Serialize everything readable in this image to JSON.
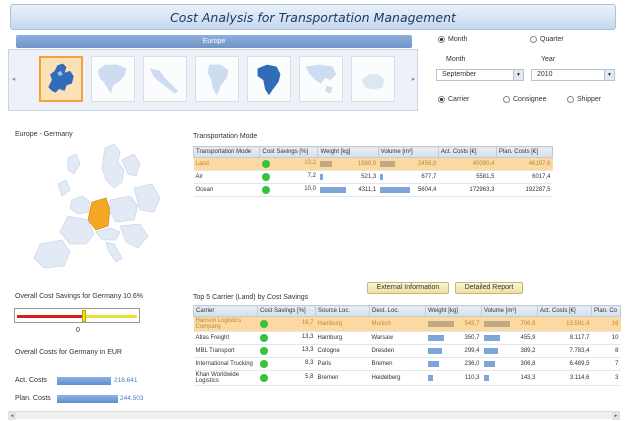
{
  "title": "Cost Analysis for Transportation Management",
  "region": {
    "label": "Europe",
    "tiles": [
      {
        "name": "europe",
        "selected": true
      },
      {
        "name": "north-america",
        "selected": false
      },
      {
        "name": "central-america",
        "selected": false
      },
      {
        "name": "south-america",
        "selected": false
      },
      {
        "name": "africa",
        "selected": false
      },
      {
        "name": "asia",
        "selected": false
      },
      {
        "name": "oceania",
        "selected": false
      }
    ]
  },
  "period": {
    "month_option": "Month",
    "quarter_option": "Quarter",
    "month_label": "Month",
    "year_label": "Year",
    "month_value": "September",
    "year_value": "2010"
  },
  "partner": {
    "carrier": "Carrier",
    "consignee": "Consignee",
    "shipper": "Shipper"
  },
  "map_title": "Europe - Germany",
  "savings": {
    "label": "Overall Cost Savings for Germany 10.6%",
    "zero": "0",
    "value_percent": 10.6
  },
  "costs": {
    "label": "Overall Costs for Germany in EUR",
    "act_label": "Act. Costs",
    "act_value": "218.641",
    "plan_label": "Plan. Costs",
    "plan_value": "244.503"
  },
  "transport_mode": {
    "title": "Transportation Mode",
    "headers": [
      "Transportation Mode",
      "Cost Savings [%]",
      "Weight [kg]",
      "Volume [m³]",
      "Act. Costs [€]",
      "Plan. Costs [€]"
    ],
    "rows": [
      {
        "mode": "Land",
        "savings": "13,2",
        "weight": "1989,9",
        "volume": "2456,9",
        "act": "40090,4",
        "plan": "46197,6",
        "highlight": true
      },
      {
        "mode": "Air",
        "savings": "7,2",
        "weight": "521,3",
        "volume": "677,7",
        "act": "5581,5",
        "plan": "6017,4",
        "highlight": false
      },
      {
        "mode": "Ocean",
        "savings": "10,0",
        "weight": "4311,1",
        "volume": "5604,4",
        "act": "172963,3",
        "plan": "192287,5",
        "highlight": false
      }
    ]
  },
  "buttons": {
    "external": "External Information",
    "report": "Detailed Report"
  },
  "top_carriers": {
    "title": "Top 5 Carrier (Land) by Cost Savings",
    "headers": [
      "Carrier",
      "Cost Savings [%]",
      "Source Loc.",
      "Dest. Loc.",
      "Weight [kg]",
      "Volume [m³]",
      "Act. Costs [€]",
      "Plan. Co"
    ],
    "rows": [
      {
        "carrier": "Hanson Logistics Company",
        "savings": "16,7",
        "source": "Hamburg",
        "dest": "Munich",
        "weight": "543,7",
        "volume": "706,8",
        "act": "13.591,4",
        "plan": "16",
        "highlight": true
      },
      {
        "carrier": "Atlas Freight",
        "savings": "13,3",
        "source": "Hamburg",
        "dest": "Warsaw",
        "weight": "350,7",
        "volume": "455,9",
        "act": "8.117,7",
        "plan": "10",
        "highlight": false
      },
      {
        "carrier": "MBL Transport",
        "savings": "13,3",
        "source": "Cologne",
        "dest": "Dresden",
        "weight": "299,4",
        "volume": "389,2",
        "act": "7.783,4",
        "plan": "8",
        "highlight": false
      },
      {
        "carrier": "International Trucking",
        "savings": "8,3",
        "source": "Paris",
        "dest": "Bremen",
        "weight": "236,0",
        "volume": "306,8",
        "act": "6.489,5",
        "plan": "7",
        "highlight": false
      },
      {
        "carrier": "Khan Worldwide Logistics",
        "savings": "5,8",
        "source": "Bremen",
        "dest": "Heidelberg",
        "weight": "110,3",
        "volume": "143,3",
        "act": "3.114,6",
        "plan": "3",
        "highlight": false
      }
    ]
  },
  "colors": {
    "accent": "#6f94c8",
    "highlight": "#fbd9a0",
    "good": "#35c23c",
    "bar": "#7ea5d8",
    "germany": "#f5a623"
  }
}
